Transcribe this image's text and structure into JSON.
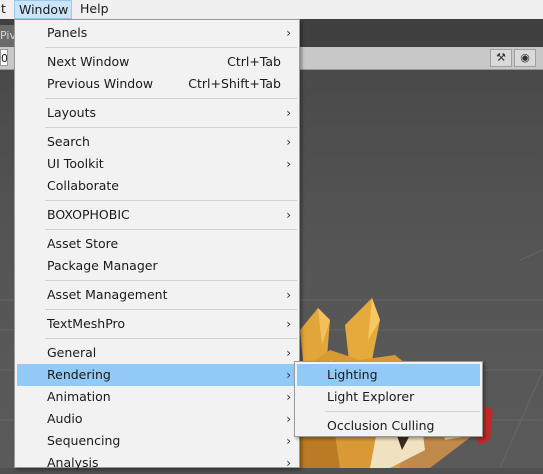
{
  "menubar": {
    "items": [
      "t",
      "Window",
      "Help"
    ]
  },
  "scene": {
    "tab_label": "Piv",
    "field_value": "0"
  },
  "window_menu": {
    "groups": [
      [
        {
          "label": "Panels",
          "submenu": true
        }
      ],
      [
        {
          "label": "Next Window",
          "shortcut": "Ctrl+Tab"
        },
        {
          "label": "Previous Window",
          "shortcut": "Ctrl+Shift+Tab"
        }
      ],
      [
        {
          "label": "Layouts",
          "submenu": true
        }
      ],
      [
        {
          "label": "Search",
          "submenu": true
        },
        {
          "label": "UI Toolkit",
          "submenu": true
        },
        {
          "label": "Collaborate"
        }
      ],
      [
        {
          "label": "BOXOPHOBIC",
          "submenu": true
        }
      ],
      [
        {
          "label": "Asset Store"
        },
        {
          "label": "Package Manager"
        }
      ],
      [
        {
          "label": "Asset Management",
          "submenu": true
        }
      ],
      [
        {
          "label": "TextMeshPro",
          "submenu": true
        }
      ],
      [
        {
          "label": "General",
          "submenu": true
        },
        {
          "label": "Rendering",
          "submenu": true,
          "highlighted": true
        },
        {
          "label": "Animation",
          "submenu": true
        },
        {
          "label": "Audio",
          "submenu": true
        },
        {
          "label": "Sequencing",
          "submenu": true
        },
        {
          "label": "Analysis",
          "submenu": true
        }
      ]
    ]
  },
  "rendering_submenu": {
    "items": [
      {
        "label": "Lighting",
        "highlighted": true
      },
      {
        "label": "Light Explorer"
      },
      {
        "label": "Occlusion Culling"
      }
    ]
  },
  "colors": {
    "highlight": "#91c9f7",
    "menu_bg": "#f2f2f2",
    "menubar_active": "#cce4f7"
  },
  "icons": {
    "submenu_arrow": "chevron-right-icon"
  }
}
